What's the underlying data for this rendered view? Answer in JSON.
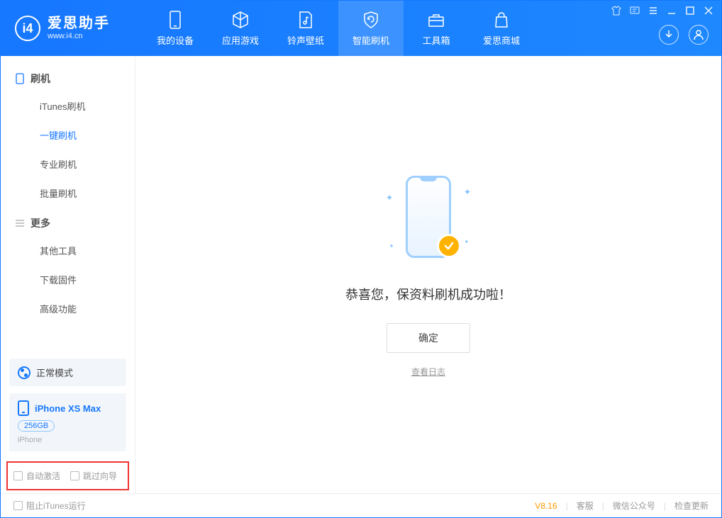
{
  "app": {
    "title": "爱思助手",
    "sub": "www.i4.cn"
  },
  "nav": {
    "items": [
      {
        "label": "我的设备"
      },
      {
        "label": "应用游戏"
      },
      {
        "label": "铃声壁纸"
      },
      {
        "label": "智能刷机"
      },
      {
        "label": "工具箱"
      },
      {
        "label": "爱思商城"
      }
    ]
  },
  "sidebar": {
    "section1": {
      "title": "刷机"
    },
    "items1": [
      {
        "label": "iTunes刷机"
      },
      {
        "label": "一键刷机"
      },
      {
        "label": "专业刷机"
      },
      {
        "label": "批量刷机"
      }
    ],
    "section2": {
      "title": "更多"
    },
    "items2": [
      {
        "label": "其他工具"
      },
      {
        "label": "下载固件"
      },
      {
        "label": "高级功能"
      }
    ],
    "mode": {
      "label": "正常模式"
    },
    "device": {
      "name": "iPhone XS Max",
      "capacity": "256GB",
      "type": "iPhone"
    },
    "opts": {
      "auto_activate": "自动激活",
      "skip_guide": "跳过向导"
    }
  },
  "main": {
    "success_msg": "恭喜您，保资料刷机成功啦！",
    "ok": "确定",
    "view_log": "查看日志"
  },
  "footer": {
    "block_itunes": "阻止iTunes运行",
    "version": "V8.16",
    "support": "客服",
    "wechat": "微信公众号",
    "check_update": "检查更新"
  }
}
